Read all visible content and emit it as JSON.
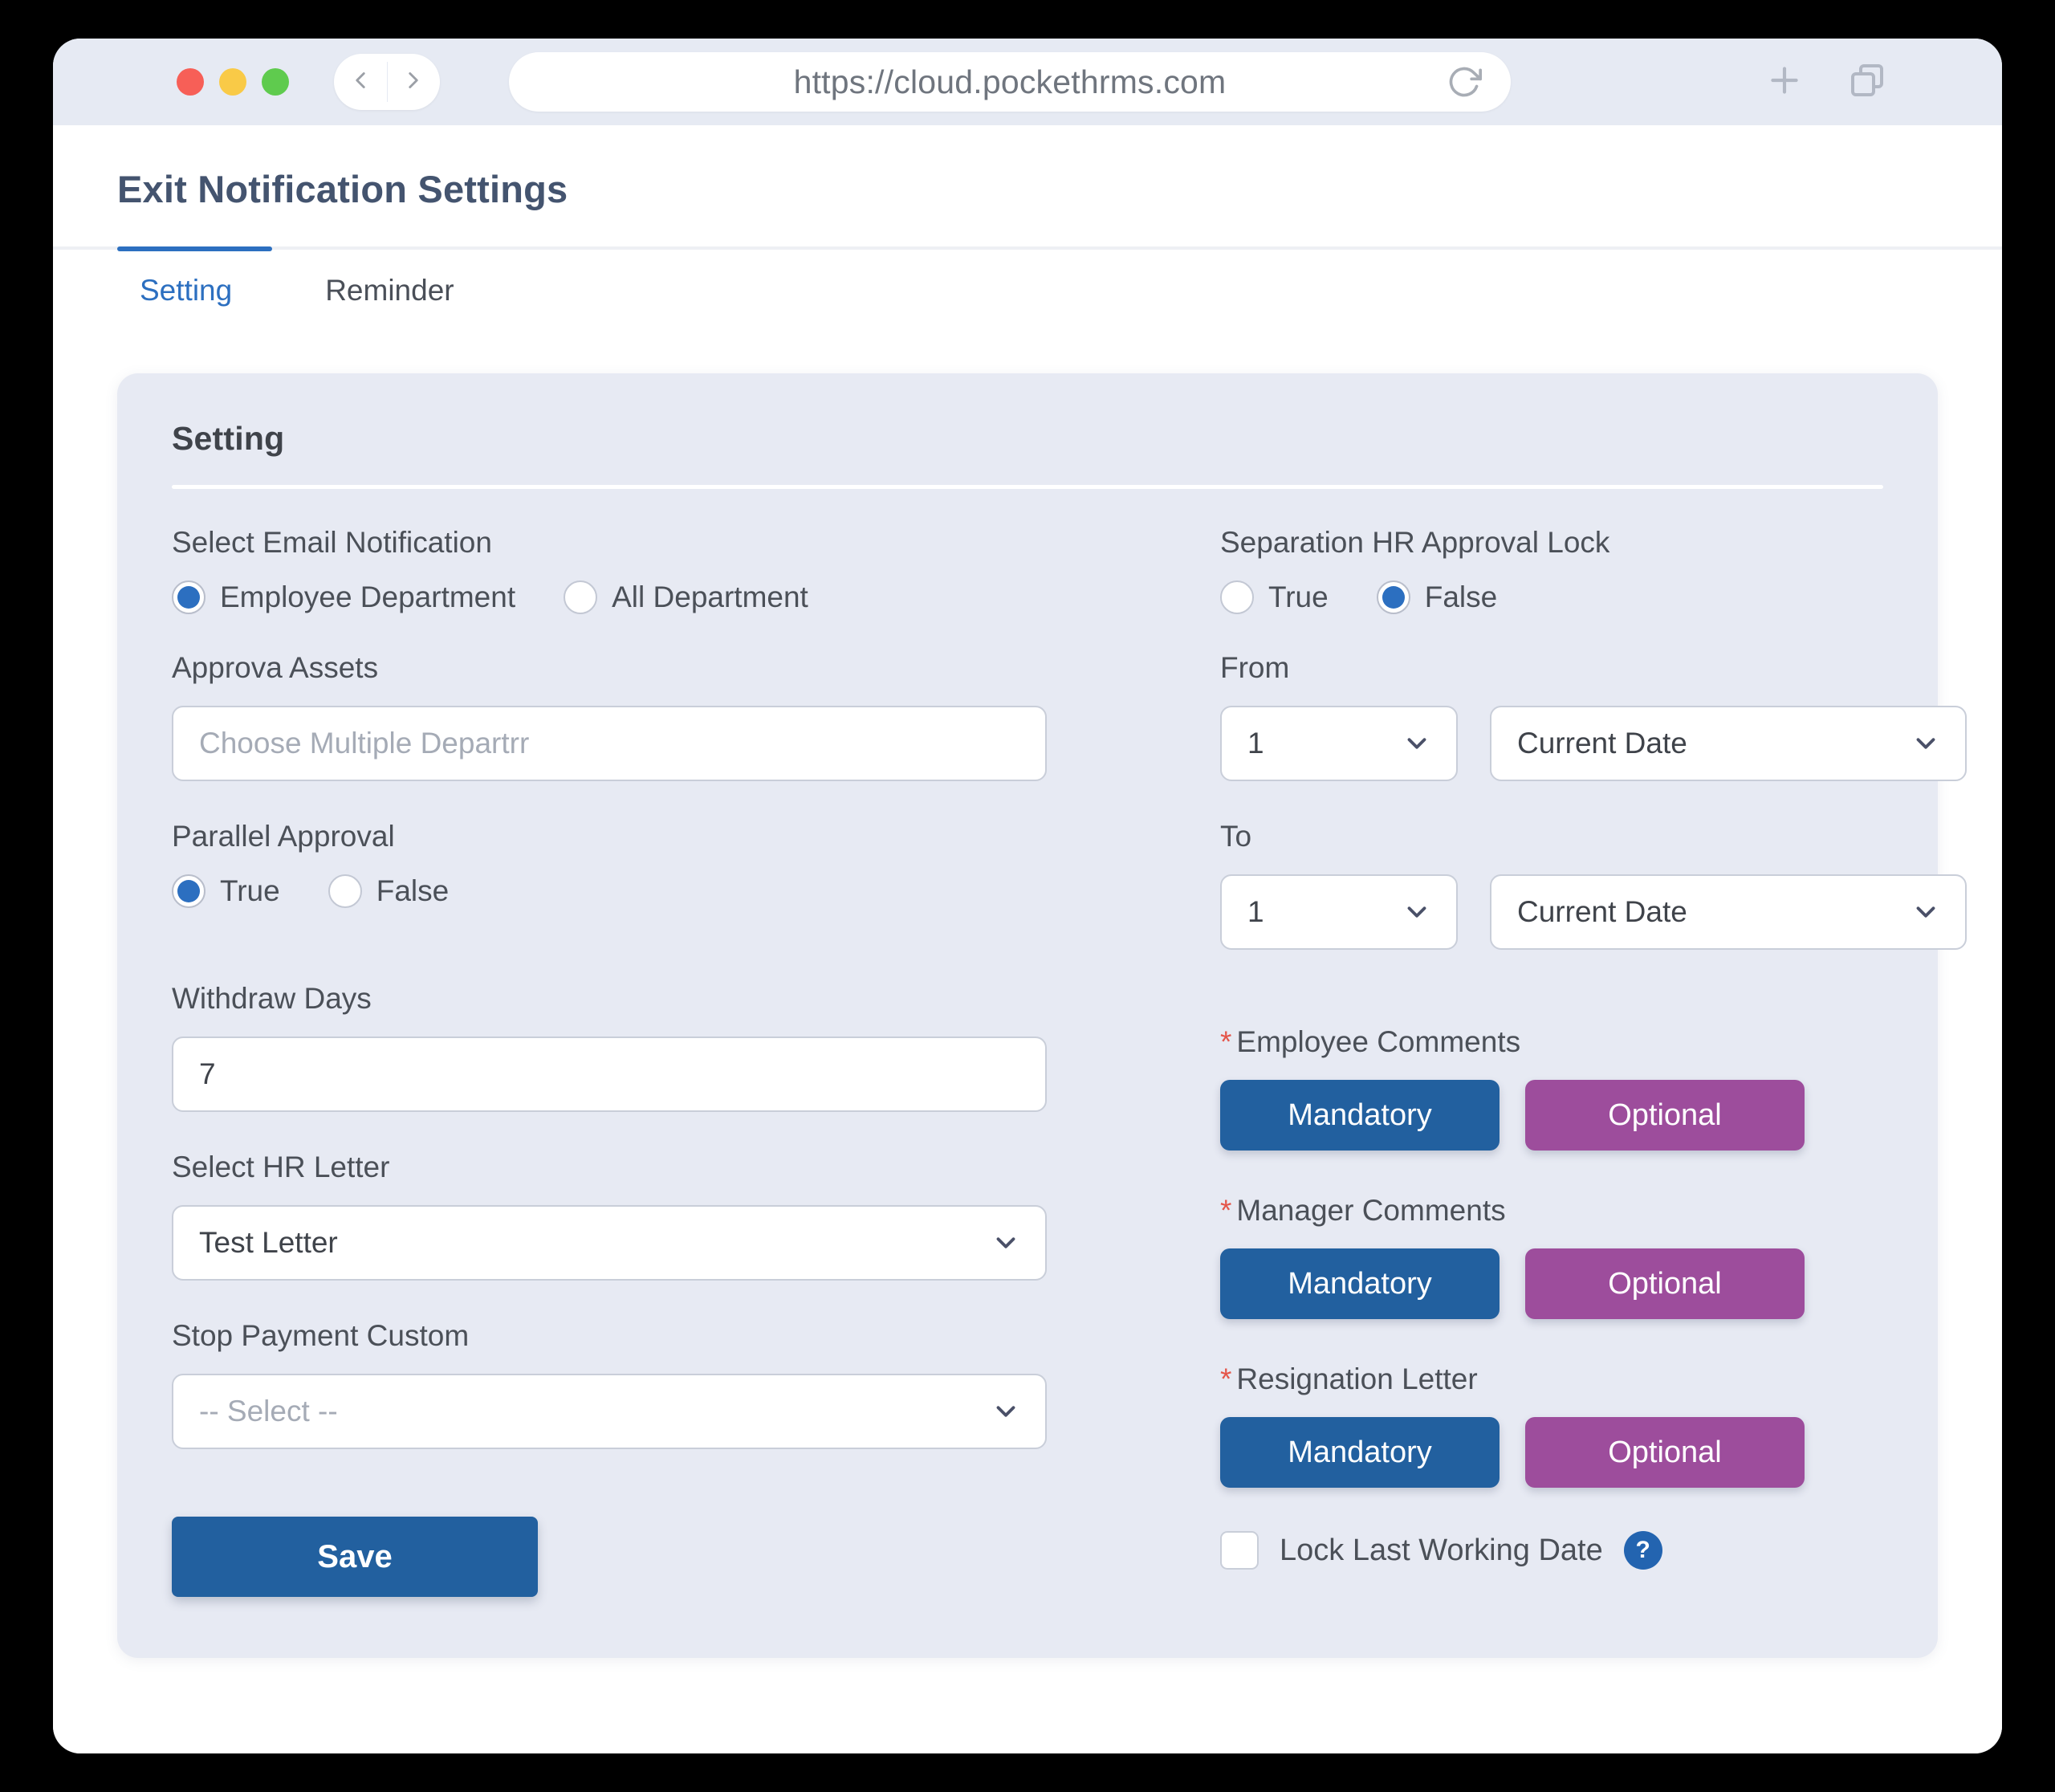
{
  "browser": {
    "url": "https://cloud.pockethrms.com",
    "back_icon": "chevron-left-icon",
    "forward_icon": "chevron-right-icon",
    "reload_icon": "reload-icon",
    "new_tab_icon": "plus-icon",
    "tabs_overview_icon": "copy-tabs-icon"
  },
  "page": {
    "title": "Exit Notification Settings",
    "tabs": [
      {
        "label": "Setting",
        "active": true
      },
      {
        "label": "Reminder",
        "active": false
      }
    ]
  },
  "card": {
    "title": "Setting"
  },
  "left": {
    "email_notification": {
      "label": "Select Email Notification",
      "options": [
        {
          "label": "Employee Department",
          "checked": true
        },
        {
          "label": "All Department",
          "checked": false
        }
      ]
    },
    "approva_assets": {
      "label": "Approva Assets",
      "placeholder": "Choose Multiple Departrr",
      "value": ""
    },
    "parallel_approval": {
      "label": "Parallel Approval",
      "options": [
        {
          "label": "True",
          "checked": true
        },
        {
          "label": "False",
          "checked": false
        }
      ]
    },
    "withdraw_days": {
      "label": "Withdraw Days",
      "value": "7"
    },
    "hr_letter": {
      "label": "Select HR Letter",
      "value": "Test Letter"
    },
    "stop_payment_custom": {
      "label": "Stop Payment Custom",
      "value": "-- Select --"
    },
    "save_label": "Save"
  },
  "right": {
    "hr_approval_lock": {
      "label": "Separation HR Approval Lock",
      "options": [
        {
          "label": "True",
          "checked": false
        },
        {
          "label": "False",
          "checked": true
        }
      ]
    },
    "from": {
      "label": "From",
      "number_value": "1",
      "date_value": "Current Date"
    },
    "to": {
      "label": "To",
      "number_value": "1",
      "date_value": "Current Date"
    },
    "employee_comments": {
      "label": "Employee Comments",
      "required_marker": "*",
      "mandatory_label": "Mandatory",
      "optional_label": "Optional"
    },
    "manager_comments": {
      "label": "Manager Comments",
      "required_marker": "*",
      "mandatory_label": "Mandatory",
      "optional_label": "Optional"
    },
    "resignation_letter": {
      "label": "Resignation Letter",
      "required_marker": "*",
      "mandatory_label": "Mandatory",
      "optional_label": "Optional"
    },
    "lock_last_working_date": {
      "label": "Lock Last Working Date",
      "checked": false,
      "help_glyph": "?"
    }
  },
  "colors": {
    "accent_blue": "#2c6fc0",
    "button_blue": "#22609f",
    "button_purple": "#9d4d9c",
    "title_navy": "#44546f",
    "card_bg": "#e7eaf3",
    "required_red": "#e4554a"
  }
}
